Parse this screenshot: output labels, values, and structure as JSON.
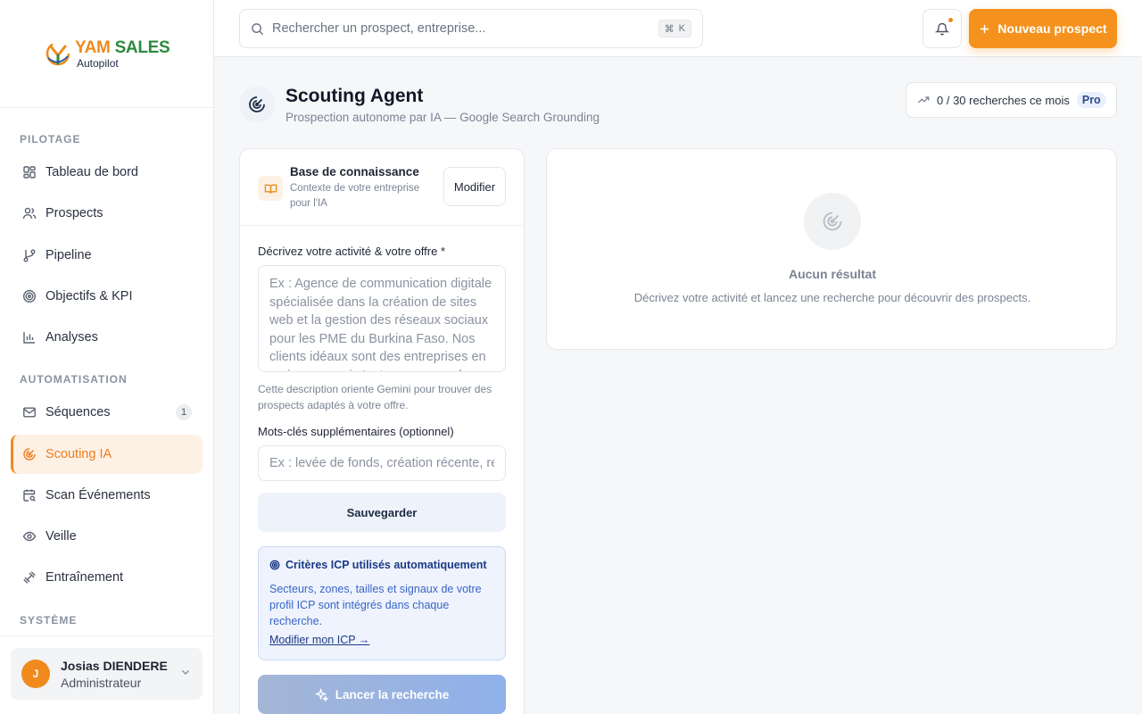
{
  "brand": {
    "name_part1": "YAM",
    "name_part2": "SALES",
    "subtitle": "Autopilot"
  },
  "sidebar": {
    "sections": [
      {
        "label": "PILOTAGE"
      },
      {
        "label": "AUTOMATISATION"
      },
      {
        "label": "SYSTÈME"
      }
    ],
    "items": [
      {
        "label": "Tableau de bord",
        "icon": "dashboard-icon"
      },
      {
        "label": "Prospects",
        "icon": "users-icon"
      },
      {
        "label": "Pipeline",
        "icon": "git-branch-icon"
      },
      {
        "label": "Objectifs & KPI",
        "icon": "target-icon"
      },
      {
        "label": "Analyses",
        "icon": "bar-chart-icon"
      },
      {
        "label": "Séquences",
        "icon": "mail-icon",
        "badge": "1"
      },
      {
        "label": "Scouting IA",
        "icon": "radar-icon",
        "active": true
      },
      {
        "label": "Scan Événements",
        "icon": "calendar-search-icon"
      },
      {
        "label": "Veille",
        "icon": "eye-icon"
      },
      {
        "label": "Entraînement",
        "icon": "dumbbell-icon"
      }
    ],
    "user": {
      "initial": "J",
      "name": "Josias DIENDERE",
      "role": "Administrateur"
    }
  },
  "topbar": {
    "search_placeholder": "Rechercher un prospect, entreprise...",
    "shortcut_key": "K",
    "new_prospect_label": "Nouveau prospect"
  },
  "page": {
    "title": "Scouting Agent",
    "subtitle": "Prospection autonome par IA — Google Search Grounding",
    "quota_text": "0 / 30 recherches ce mois",
    "plan_badge": "Pro"
  },
  "knowledge_base": {
    "title": "Base de connaissance",
    "description": "Contexte de votre entreprise pour l'IA",
    "modify_label": "Modifier"
  },
  "form": {
    "activity_label": "Décrivez votre activité & votre offre *",
    "activity_placeholder": "Ex : Agence de communication digitale spécialisée dans la création de sites web et la gestion des réseaux sociaux pour les PME du Burkina Faso. Nos clients idéaux sont des entreprises en croissance qui n'ont pas encore de",
    "activity_hint": "Cette description oriente Gemini pour trouver des prospects adaptés à votre offre.",
    "keywords_label": "Mots-clés supplémentaires (optionnel)",
    "keywords_placeholder": "Ex : levée de fonds, création récente, recrutement",
    "save_label": "Sauvegarder",
    "icp_title": "Critères ICP utilisés automatiquement",
    "icp_text": "Secteurs, zones, tailles et signaux de votre profil ICP sont intégrés dans chaque recherche.",
    "icp_link": "Modifier mon ICP →",
    "run_label": "Lancer la recherche"
  },
  "results": {
    "empty_title": "Aucun résultat",
    "empty_desc": "Décrivez votre activité et lancez une recherche pour découvrir des prospects."
  },
  "colors": {
    "accent": "#f5921e",
    "active_bg": "#fdf1e6",
    "brand_green": "#2c8a3c",
    "icp_blue": "#3a64c8"
  }
}
